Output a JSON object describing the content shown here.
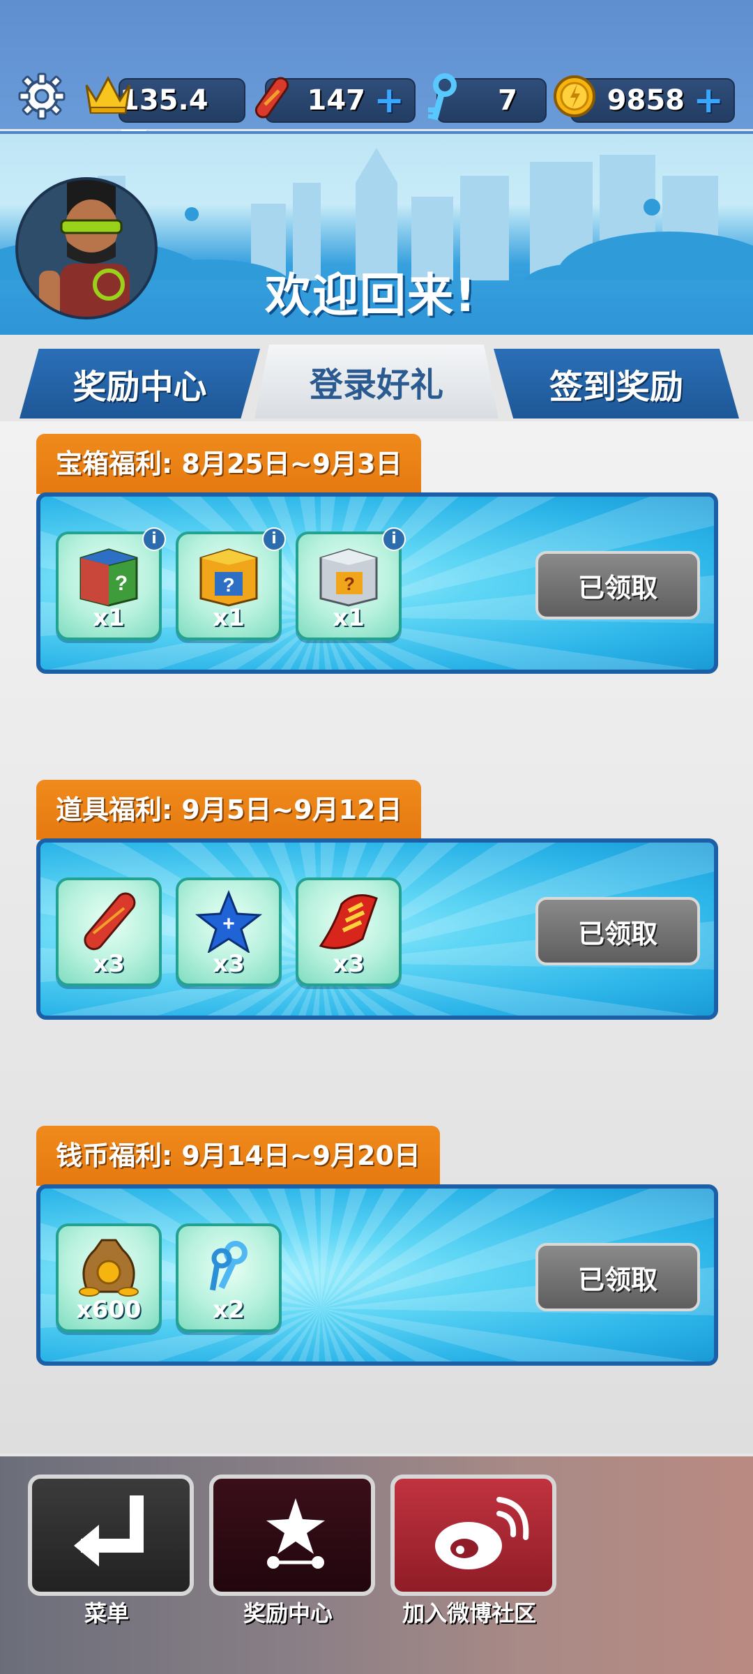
{
  "stats": {
    "crown": "135.4万",
    "hoverboards": "147",
    "keys": "7",
    "coins": "9858",
    "plus": "+"
  },
  "header": {
    "welcome": "欢迎回来!"
  },
  "tabs": [
    {
      "label": "奖励中心"
    },
    {
      "label": "登录好礼"
    },
    {
      "label": "签到奖励"
    }
  ],
  "sections": [
    {
      "label": "宝箱福利: 8月25日~9月3日",
      "items": [
        {
          "icon": "green-mystery-box-icon",
          "qty": "x1"
        },
        {
          "icon": "orange-mystery-box-icon",
          "qty": "x1"
        },
        {
          "icon": "silver-mystery-box-icon",
          "qty": "x1"
        }
      ],
      "button": "已领取"
    },
    {
      "label": "道具福利: 9月5日~9月12日",
      "items": [
        {
          "icon": "hoverboard-icon",
          "qty": "x3"
        },
        {
          "icon": "score-booster-star-icon",
          "qty": "x3"
        },
        {
          "icon": "headstart-icon",
          "qty": "x3"
        }
      ],
      "button": "已领取"
    },
    {
      "label": "钱币福利: 9月14日~9月20日",
      "items": [
        {
          "icon": "coin-bag-icon",
          "qty": "x600"
        },
        {
          "icon": "keys-icon",
          "qty": "x2"
        }
      ],
      "button": "已领取"
    }
  ],
  "info_badge": "i",
  "bottom_nav": [
    {
      "label": "菜单",
      "icon": "return-arrow-icon"
    },
    {
      "label": "奖励中心",
      "icon": "reward-star-icon"
    },
    {
      "label": "加入微博社区",
      "icon": "weibo-icon"
    }
  ]
}
